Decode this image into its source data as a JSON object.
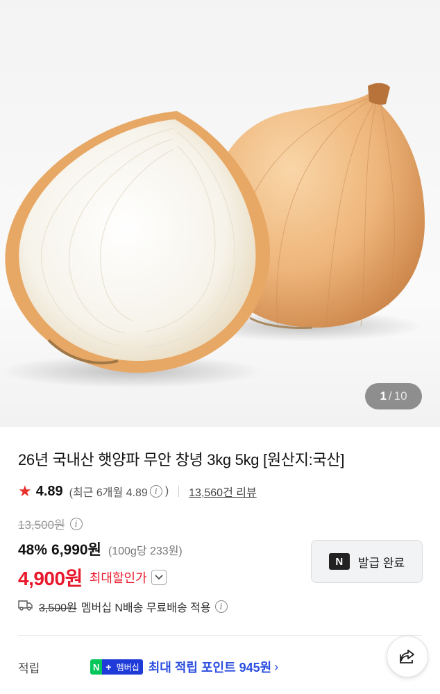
{
  "gallery": {
    "current": "1",
    "separator": "/",
    "total": "10",
    "image_icon": "onion-photo"
  },
  "product": {
    "title": "26년 국내산 햇양파 무안 창녕 3kg 5kg [원산지:국산]",
    "rating": "4.89",
    "rating_recent": "(최근 6개월 4.89",
    "rating_recent_close": ")",
    "review_count": "13,560건 리뷰",
    "original_price": "13,500원",
    "discount_rate": "48%",
    "discount_price": "6,990원",
    "unit_price": "(100g당 233원)",
    "max_discount_price": "4,900원",
    "max_discount_label": "최대할인가",
    "shipping_fee": "3,500원",
    "shipping_text": "멤버십 N배송 무료배송 적용"
  },
  "coupon": {
    "badge": "N",
    "label": "발급 완료"
  },
  "points": {
    "label": "적립",
    "badge_n": "N",
    "badge_plus": "+",
    "badge_membership": "멤버십",
    "text": "최대 적립 포인트 945원",
    "chevron": "›"
  },
  "colors": {
    "accent_red": "#e8192c",
    "star": "#e8302b",
    "naver_green": "#03c75a",
    "membership_blue": "#1e3bd8"
  }
}
